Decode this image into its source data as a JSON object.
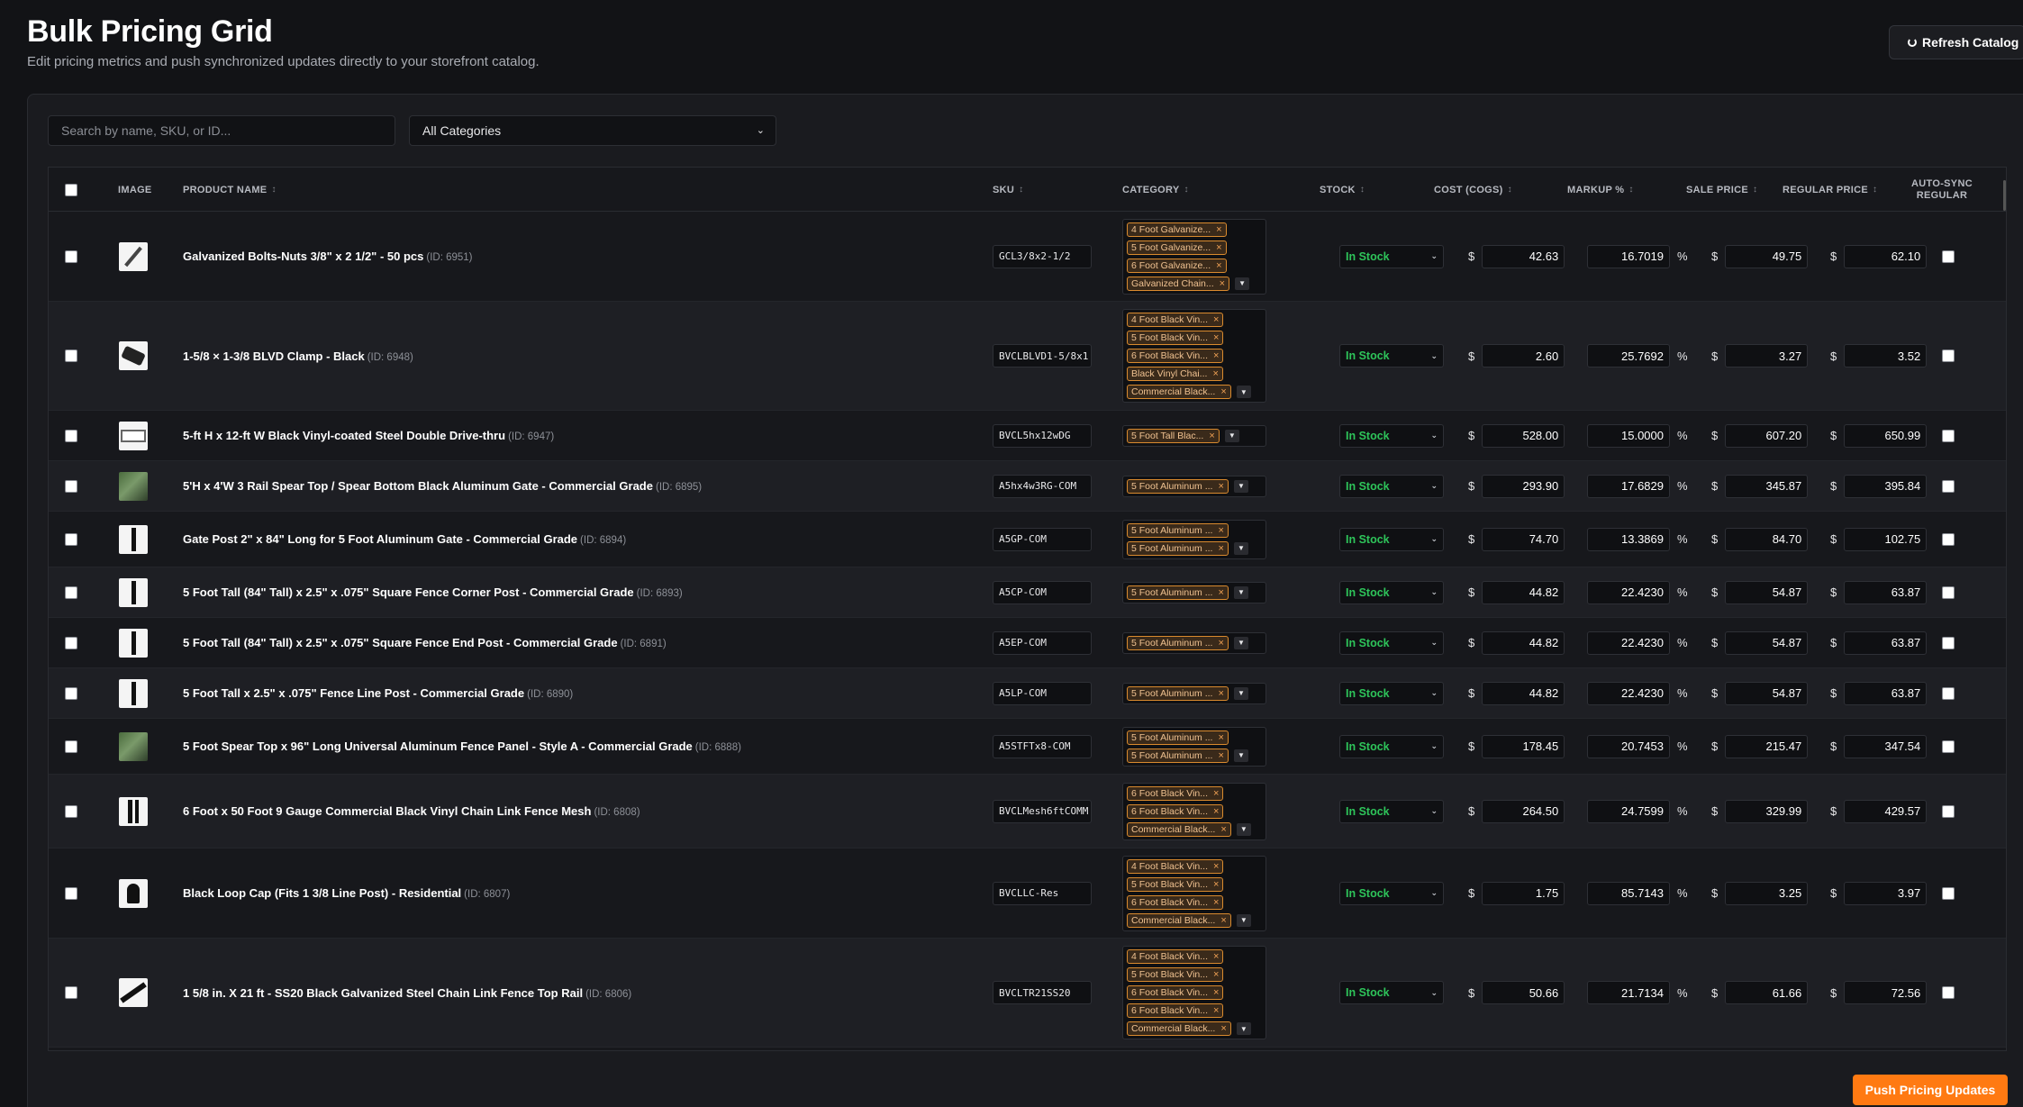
{
  "header": {
    "title": "Bulk Pricing Grid",
    "subtitle": "Edit pricing metrics and push synchronized updates directly to your storefront catalog.",
    "refresh_label": "Refresh Catalog"
  },
  "filters": {
    "search_placeholder": "Search by name, SKU, or ID...",
    "category_selected": "All Categories"
  },
  "columns": {
    "image": "IMAGE",
    "name": "PRODUCT NAME",
    "sku": "SKU",
    "category": "CATEGORY",
    "stock": "STOCK",
    "cost": "COST (COGS)",
    "markup": "MARKUP %",
    "sale": "SALE PRICE",
    "regular": "REGULAR PRICE",
    "autosync": "AUTO-SYNC REGULAR",
    "sort_icon": "↕"
  },
  "currency": "$",
  "percent": "%",
  "products": [
    {
      "name": "Galvanized Bolts-Nuts 3/8\" x 2 1/2\" - 50 pcs",
      "id": "(ID: 6951)",
      "sku": "GCL3/8x2-1/2",
      "categories": [
        "4 Foot Galvanize...",
        "5 Foot Galvanize...",
        "6 Foot Galvanize...",
        "Galvanized Chain..."
      ],
      "stock": "In Stock",
      "cost": "42.63",
      "markup": "16.7019",
      "sale": "49.75",
      "regular": "62.10",
      "thumb": "bolt"
    },
    {
      "name": "1-5/8 × 1-3/8 BLVD Clamp - Black",
      "id": "(ID: 6948)",
      "sku": "BVCLBLVD1-5/8x1",
      "categories": [
        "4 Foot Black Vin...",
        "5 Foot Black Vin...",
        "6 Foot Black Vin...",
        "Black Vinyl Chai...",
        "Commercial Black..."
      ],
      "stock": "In Stock",
      "cost": "2.60",
      "markup": "25.7692",
      "sale": "3.27",
      "regular": "3.52",
      "thumb": "clamp"
    },
    {
      "name": "5-ft H x 12-ft W Black Vinyl-coated Steel Double Drive-thru",
      "id": "(ID: 6947)",
      "sku": "BVCL5hx12wDG",
      "categories": [
        "5 Foot Tall Blac..."
      ],
      "stock": "In Stock",
      "cost": "528.00",
      "markup": "15.0000",
      "sale": "607.20",
      "regular": "650.99",
      "thumb": "gate"
    },
    {
      "name": "5'H x 4'W 3 Rail Spear Top / Spear Bottom Black Aluminum Gate - Commercial Grade",
      "id": "(ID: 6895)",
      "sku": "A5hx4w3RG-COM",
      "categories": [
        "5 Foot Aluminum ..."
      ],
      "stock": "In Stock",
      "cost": "293.90",
      "markup": "17.6829",
      "sale": "345.87",
      "regular": "395.84",
      "thumb": "photo"
    },
    {
      "name": "Gate Post 2\" x 84\" Long for 5 Foot Aluminum Gate - Commercial Grade",
      "id": "(ID: 6894)",
      "sku": "A5GP-COM",
      "categories": [
        "5 Foot Aluminum ...",
        "5 Foot Aluminum ..."
      ],
      "stock": "In Stock",
      "cost": "74.70",
      "markup": "13.3869",
      "sale": "84.70",
      "regular": "102.75",
      "thumb": "bar"
    },
    {
      "name": "5 Foot Tall (84\" Tall) x 2.5\" x .075\" Square Fence Corner Post - Commercial Grade",
      "id": "(ID: 6893)",
      "sku": "A5CP-COM",
      "categories": [
        "5 Foot Aluminum ..."
      ],
      "stock": "In Stock",
      "cost": "44.82",
      "markup": "22.4230",
      "sale": "54.87",
      "regular": "63.87",
      "thumb": "bar"
    },
    {
      "name": "5 Foot Tall (84\" Tall) x 2.5\" x .075\" Square Fence End Post - Commercial Grade",
      "id": "(ID: 6891)",
      "sku": "A5EP-COM",
      "categories": [
        "5 Foot Aluminum ..."
      ],
      "stock": "In Stock",
      "cost": "44.82",
      "markup": "22.4230",
      "sale": "54.87",
      "regular": "63.87",
      "thumb": "bar"
    },
    {
      "name": "5 Foot Tall x 2.5\" x .075\" Fence Line Post - Commercial Grade",
      "id": "(ID: 6890)",
      "sku": "A5LP-COM",
      "categories": [
        "5 Foot Aluminum ..."
      ],
      "stock": "In Stock",
      "cost": "44.82",
      "markup": "22.4230",
      "sale": "54.87",
      "regular": "63.87",
      "thumb": "bar"
    },
    {
      "name": "5 Foot Spear Top x 96\" Long Universal Aluminum Fence Panel - Style A - Commercial Grade",
      "id": "(ID: 6888)",
      "sku": "A5STFTx8-COM",
      "categories": [
        "5 Foot Aluminum ...",
        "5 Foot Aluminum ..."
      ],
      "stock": "In Stock",
      "cost": "178.45",
      "markup": "20.7453",
      "sale": "215.47",
      "regular": "347.54",
      "thumb": "photo"
    },
    {
      "name": "6 Foot x 50 Foot 9 Gauge Commercial Black Vinyl Chain Link Fence Mesh",
      "id": "(ID: 6808)",
      "sku": "BVCLMesh6ftCOMM",
      "categories": [
        "6 Foot Black Vin...",
        "6 Foot Black Vin...",
        "Commercial Black..."
      ],
      "stock": "In Stock",
      "cost": "264.50",
      "markup": "24.7599",
      "sale": "329.99",
      "regular": "429.57",
      "thumb": "bar2"
    },
    {
      "name": "Black Loop Cap (Fits 1 3/8 Line Post) - Residential",
      "id": "(ID: 6807)",
      "sku": "BVCLLC-Res",
      "categories": [
        "4 Foot Black Vin...",
        "5 Foot Black Vin...",
        "6 Foot Black Vin...",
        "Commercial Black..."
      ],
      "stock": "In Stock",
      "cost": "1.75",
      "markup": "85.7143",
      "sale": "3.25",
      "regular": "3.97",
      "thumb": "loop"
    },
    {
      "name": "1 5/8 in. X 21 ft - SS20 Black Galvanized Steel Chain Link Fence Top Rail",
      "id": "(ID: 6806)",
      "sku": "BVCLTR21SS20",
      "categories": [
        "4 Foot Black Vin...",
        "5 Foot Black Vin...",
        "6 Foot Black Vin...",
        "6 Foot Black Vin...",
        "Commercial Black..."
      ],
      "stock": "In Stock",
      "cost": "50.66",
      "markup": "21.7134",
      "sale": "61.66",
      "regular": "72.56",
      "thumb": "diag"
    }
  ],
  "footer": {
    "push_label": "Push Pricing Updates"
  },
  "colors": {
    "accent": "#ff7a12",
    "in_stock": "#2ec45a",
    "tag_border": "#d98a2e",
    "background": "#121316"
  }
}
